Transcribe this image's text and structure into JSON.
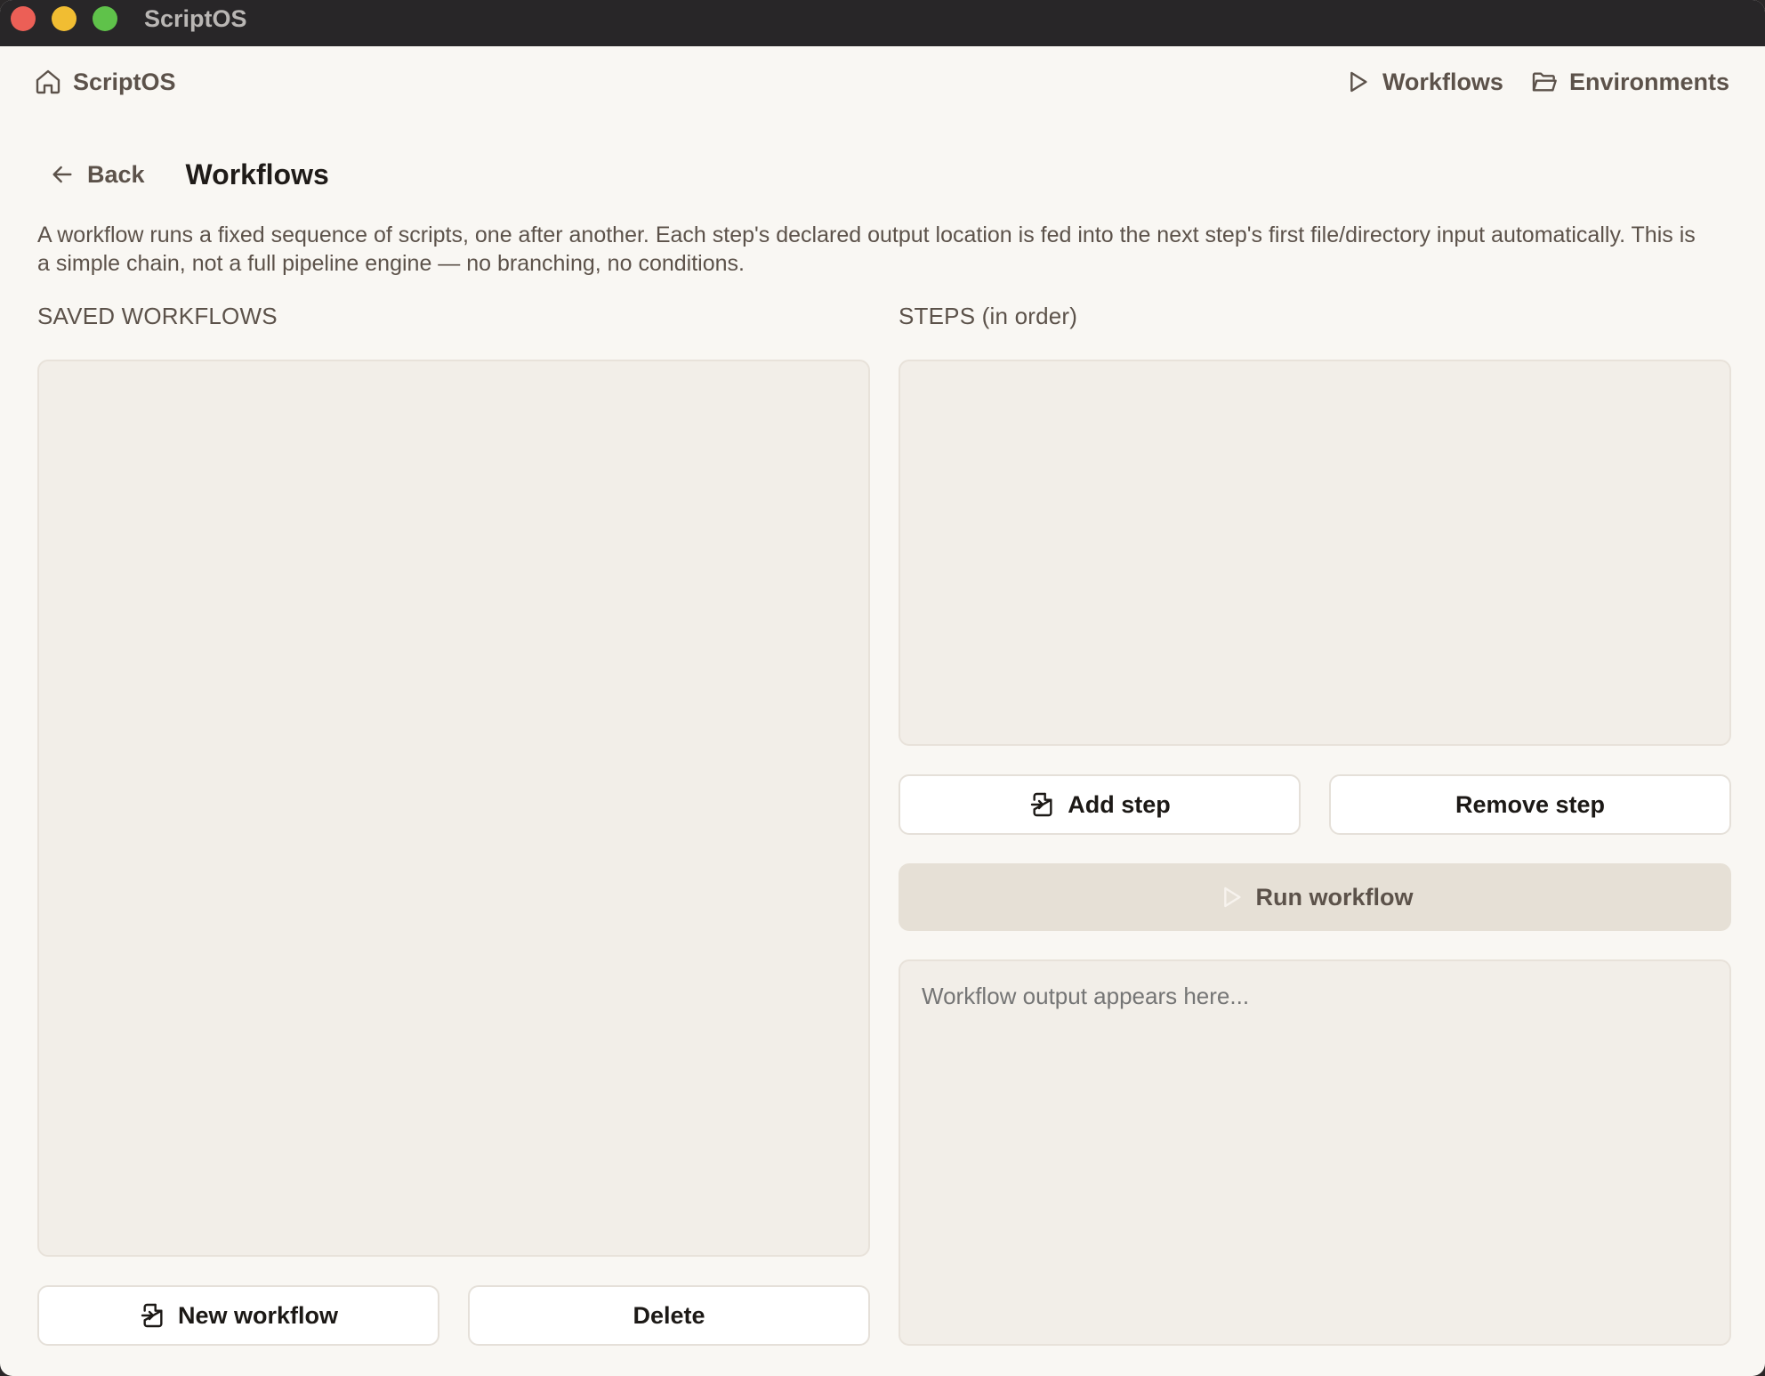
{
  "window": {
    "title": "ScriptOS"
  },
  "nav": {
    "home_label": "ScriptOS",
    "home_icon": "home-icon",
    "links": [
      {
        "label": "Workflows",
        "icon": "play-icon"
      },
      {
        "label": "Environments",
        "icon": "folder-open-icon"
      }
    ]
  },
  "page": {
    "back_label": "Back",
    "title": "Workflows",
    "description": "A workflow runs a fixed sequence of scripts, one after another. Each step's declared output location is fed into the next step's first file/directory input automatically. This is a simple chain, not a full pipeline engine — no branching, no conditions."
  },
  "saved_workflows": {
    "label": "SAVED WORKFLOWS",
    "items": [],
    "new_button_label": "New workflow",
    "delete_button_label": "Delete"
  },
  "steps": {
    "label": "STEPS (in order)",
    "items": [],
    "add_button_label": "Add step",
    "remove_button_label": "Remove step",
    "run_button_label": "Run workflow"
  },
  "output": {
    "placeholder": "Workflow output appears here...",
    "value": ""
  },
  "colors": {
    "background": "#f9f7f3",
    "panel": "#f2eee8",
    "text_primary": "#1f1b18",
    "text_muted": "#5c524a",
    "run_button_disabled": "#e6e0d6",
    "traffic_close": "#ec5f56",
    "traffic_min": "#f1bd32",
    "traffic_max": "#5fc24a"
  }
}
